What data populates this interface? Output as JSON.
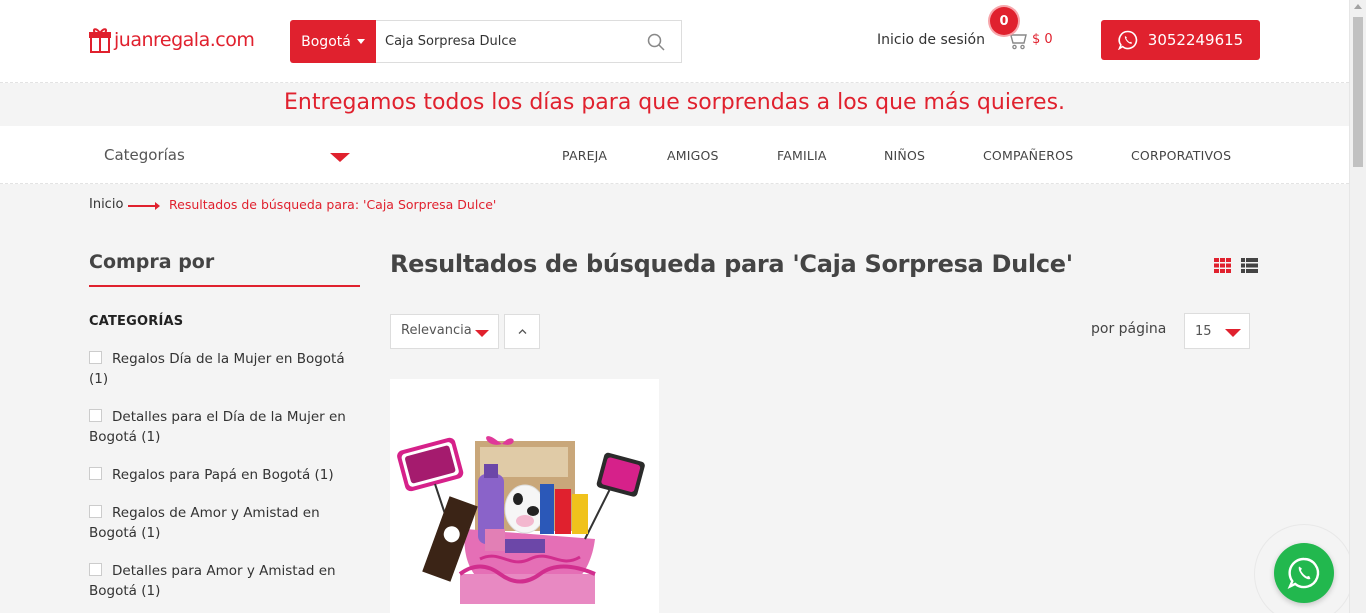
{
  "header": {
    "brand": "juanregala.com",
    "city": "Bogotá",
    "search_value": "Caja Sorpresa Dulce",
    "login": "Inicio de sesión",
    "cart_count": "0",
    "cart_total": "$ 0",
    "phone": "3052249615"
  },
  "promo": "Entregamos todos los días para que sorprendas a los que más quieres.",
  "nav": {
    "categories": "Categorías",
    "items": [
      "PAREJA",
      "AMIGOS",
      "FAMILIA",
      "NIÑOS",
      "COMPAÑEROS",
      "CORPORATIVOS"
    ]
  },
  "breadcrumb": {
    "home": "Inicio",
    "current": "Resultados de búsqueda para: 'Caja Sorpresa Dulce'"
  },
  "sidebar": {
    "title": "Compra por",
    "heading": "CATEGORÍAS",
    "filters": [
      {
        "label": "Regalos Día de la Mujer en Bogotá",
        "count": "(1)"
      },
      {
        "label": "Detalles para el Día de la Mujer en Bogotá",
        "count": "(1)"
      },
      {
        "label": "Regalos para Papá en Bogotá",
        "count": "(1)"
      },
      {
        "label": "Regalos de Amor y Amistad en Bogotá",
        "count": "(1)"
      },
      {
        "label": "Detalles para Amor y Amistad en Bogotá",
        "count": "(1)"
      }
    ]
  },
  "main": {
    "title": "Resultados de búsqueda para 'Caja Sorpresa Dulce'",
    "sort": "Relevancia",
    "per_page_label": "por página",
    "per_page": "15"
  },
  "colors": {
    "accent": "#e0212e",
    "whatsapp": "#22b84e"
  }
}
